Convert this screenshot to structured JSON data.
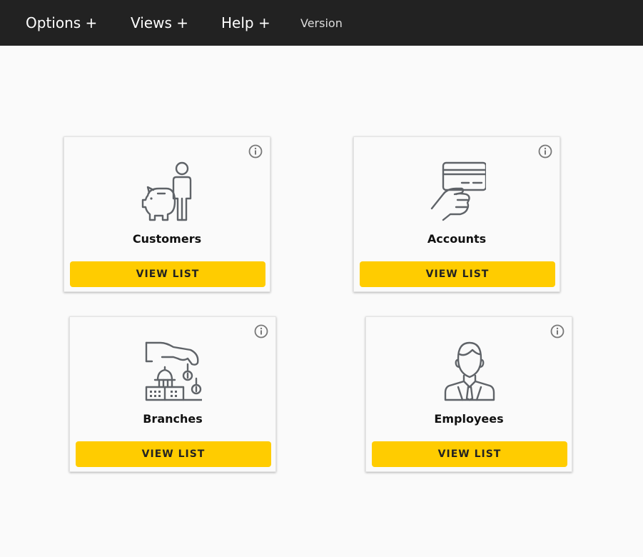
{
  "nav": {
    "options": "Options +",
    "views": "Views +",
    "help": "Help +",
    "version": "Version"
  },
  "cards": [
    {
      "title": "Customers",
      "button": "VIEW LIST",
      "icon": "piggy-bank-person-icon"
    },
    {
      "title": "Accounts",
      "button": "VIEW LIST",
      "icon": "hand-credit-card-icon"
    },
    {
      "title": "Branches",
      "button": "VIEW LIST",
      "icon": "bank-building-coins-icon"
    },
    {
      "title": "Employees",
      "button": "VIEW LIST",
      "icon": "employee-icon"
    }
  ],
  "colors": {
    "topbar": "#222222",
    "accent": "#ffcc00",
    "icon": "#5f6368",
    "background": "#fafafa"
  }
}
